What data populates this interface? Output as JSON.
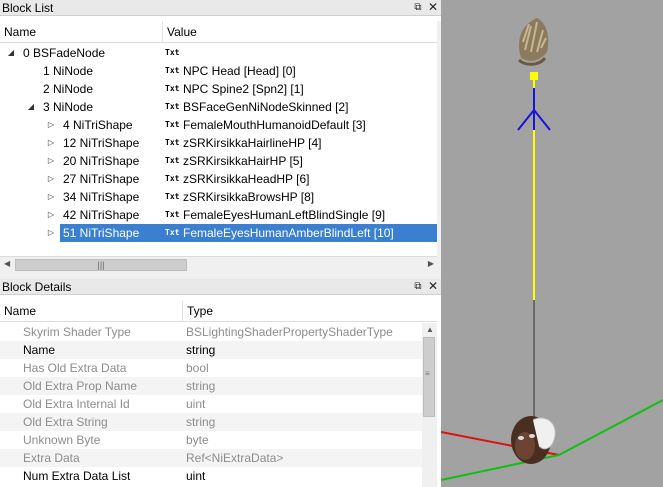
{
  "block_list": {
    "title": "Block List",
    "columns": {
      "name": "Name",
      "value": "Value"
    },
    "txt_badge": "Txt",
    "rows": [
      {
        "name": "0 BSFadeNode",
        "value": "",
        "indent": 0,
        "arrow": "expanded",
        "selected": false
      },
      {
        "name": "1 NiNode",
        "value": "NPC Head [Head] [0]",
        "indent": 1,
        "arrow": "none",
        "selected": false
      },
      {
        "name": "2 NiNode",
        "value": "NPC Spine2 [Spn2] [1]",
        "indent": 1,
        "arrow": "none",
        "selected": false
      },
      {
        "name": "3 NiNode",
        "value": "BSFaceGenNiNodeSkinned [2]",
        "indent": 1,
        "arrow": "expanded",
        "selected": false
      },
      {
        "name": "4 NiTriShape",
        "value": "FemaleMouthHumanoidDefault [3]",
        "indent": 2,
        "arrow": "collapsed",
        "selected": false
      },
      {
        "name": "12 NiTriShape",
        "value": "zSRKirsikkaHairlineHP [4]",
        "indent": 2,
        "arrow": "collapsed",
        "selected": false
      },
      {
        "name": "20 NiTriShape",
        "value": "zSRKirsikkaHairHP [5]",
        "indent": 2,
        "arrow": "collapsed",
        "selected": false
      },
      {
        "name": "27 NiTriShape",
        "value": "zSRKirsikkaHeadHP [6]",
        "indent": 2,
        "arrow": "collapsed",
        "selected": false
      },
      {
        "name": "34 NiTriShape",
        "value": "zSRKirsikkaBrowsHP [8]",
        "indent": 2,
        "arrow": "collapsed",
        "selected": false
      },
      {
        "name": "42 NiTriShape",
        "value": "FemaleEyesHumanLeftBlindSingle [9]",
        "indent": 2,
        "arrow": "collapsed",
        "selected": false
      },
      {
        "name": "51 NiTriShape",
        "value": "FemaleEyesHumanAmberBlindLeft [10]",
        "indent": 2,
        "arrow": "collapsed",
        "selected": true
      }
    ]
  },
  "block_details": {
    "title": "Block Details",
    "columns": {
      "name": "Name",
      "type": "Type"
    },
    "rows": [
      {
        "name": "Skyrim Shader Type",
        "type": "BSLightingShaderPropertyShaderType",
        "dim": true
      },
      {
        "name": "Name",
        "type": "string",
        "dim": false
      },
      {
        "name": "Has Old Extra Data",
        "type": "bool",
        "dim": true
      },
      {
        "name": "Old Extra Prop Name",
        "type": "string",
        "dim": true
      },
      {
        "name": "Old Extra Internal Id",
        "type": "uint",
        "dim": true
      },
      {
        "name": "Old Extra String",
        "type": "string",
        "dim": true
      },
      {
        "name": "Unknown Byte",
        "type": "byte",
        "dim": true
      },
      {
        "name": "Extra Data",
        "type": "Ref<NiExtraData>",
        "dim": true
      },
      {
        "name": "Num Extra Data List",
        "type": "uint",
        "dim": false
      }
    ]
  },
  "colors": {
    "selection": "#3a7fd0",
    "viewport_bg": "#a2a2a2",
    "axis_x": "#e01010",
    "axis_y": "#10c010",
    "axis_z": "#1515e0",
    "bone_line": "#ffff00"
  },
  "icons": {
    "float": "float-window-icon",
    "close": "close-icon"
  }
}
